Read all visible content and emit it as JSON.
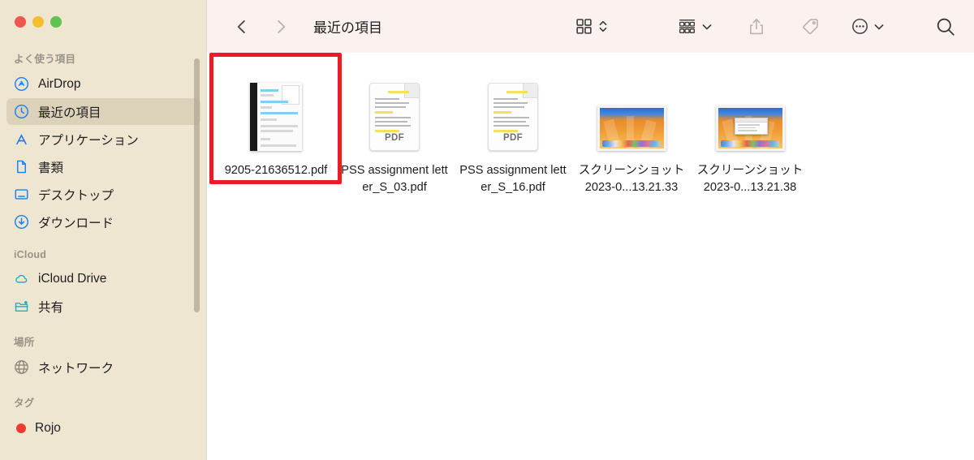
{
  "window": {
    "traffic_lights": [
      {
        "name": "close",
        "color": "#F1554F"
      },
      {
        "name": "minimize",
        "color": "#F6BD2F"
      },
      {
        "name": "zoom",
        "color": "#5EC44F"
      }
    ]
  },
  "toolbar": {
    "back_label": "‹",
    "forward_label": "›",
    "title": "最近の項目",
    "items": [
      {
        "name": "view-icon-grid",
        "label": "",
        "icon": "grid-view-icon"
      },
      {
        "name": "view-sort",
        "label": "",
        "icon": "chevron-up-down-icon"
      },
      {
        "name": "group-by",
        "label": "",
        "icon": "group-by-icon"
      },
      {
        "name": "group-by-menu",
        "label": "",
        "icon": "chevron-down-icon"
      },
      {
        "name": "share",
        "label": "",
        "icon": "share-icon"
      },
      {
        "name": "tags",
        "label": "",
        "icon": "tag-icon"
      },
      {
        "name": "more-actions",
        "label": "",
        "icon": "ellipsis-circle-icon"
      },
      {
        "name": "more-menu",
        "label": "",
        "icon": "chevron-down-icon"
      },
      {
        "name": "search",
        "label": "",
        "icon": "search-icon"
      }
    ]
  },
  "sidebar": {
    "sections": [
      {
        "header": "よく使う項目",
        "items": [
          {
            "label": "AirDrop",
            "icon": "airdrop-icon",
            "selected": false
          },
          {
            "label": "最近の項目",
            "icon": "clock-icon",
            "selected": true
          },
          {
            "label": "アプリケーション",
            "icon": "app-store-icon",
            "selected": false
          },
          {
            "label": "書類",
            "icon": "document-icon",
            "selected": false
          },
          {
            "label": "デスクトップ",
            "icon": "desktop-icon",
            "selected": false
          },
          {
            "label": "ダウンロード",
            "icon": "download-icon",
            "selected": false
          }
        ]
      },
      {
        "header": "iCloud",
        "items": [
          {
            "label": "iCloud Drive",
            "icon": "cloud-icon",
            "selected": false
          },
          {
            "label": "共有",
            "icon": "shared-folder-icon",
            "selected": false
          }
        ]
      },
      {
        "header": "場所",
        "items": [
          {
            "label": "ネットワーク",
            "icon": "globe-icon",
            "selected": false
          }
        ]
      },
      {
        "header": "タグ",
        "items": [
          {
            "label": "Rojo",
            "icon": "tag-dot-icon",
            "color": "#EE3B33",
            "selected": false
          }
        ]
      }
    ]
  },
  "content": {
    "files": [
      {
        "name": "9205-21636512.pdf",
        "thumb": "scanned-document",
        "highlighted": true
      },
      {
        "name": "PSS assignment letter_S_03.pdf",
        "thumb": "pdf",
        "highlighted": false
      },
      {
        "name": "PSS assignment letter_S_16.pdf",
        "thumb": "pdf",
        "highlighted": false
      },
      {
        "name": "スクリーンショット 2023-0...13.21.33",
        "thumb": "screenshot",
        "highlighted": false
      },
      {
        "name": "スクリーンショット 2023-0...13.21.38",
        "thumb": "screenshot-window",
        "highlighted": false
      }
    ],
    "pdf_badge": "PDF"
  },
  "colors": {
    "sidebar_bg": "#EFE6D2",
    "toolbar_bg": "#FBF2F0",
    "content_bg": "#FFFFFF",
    "selection_bg": "#DCD2BA",
    "highlight_box": "#ED1C24",
    "icon_blue": "#1a7ef5",
    "icon_teal": "#19b3c9"
  }
}
